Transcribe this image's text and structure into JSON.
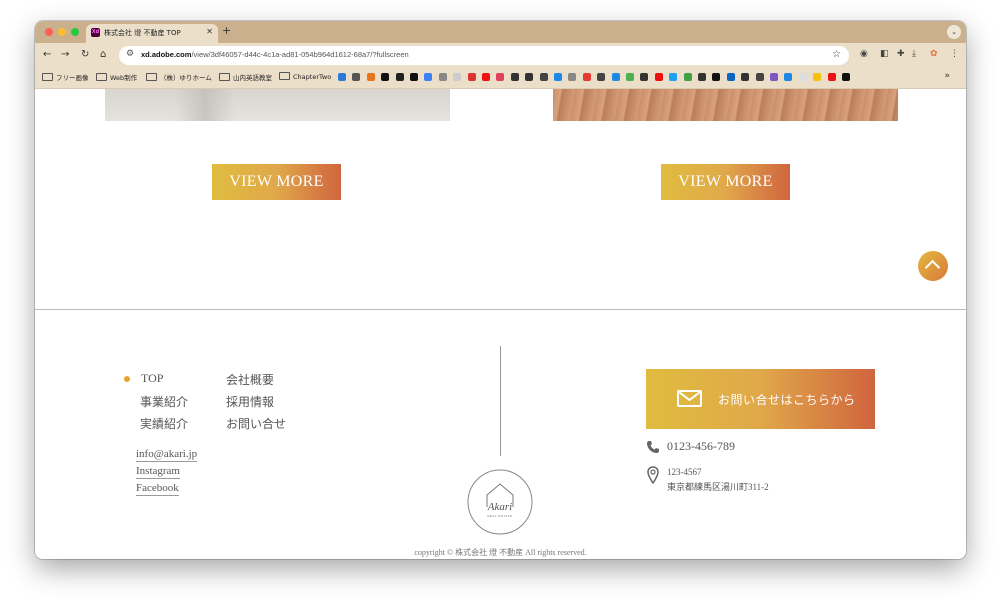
{
  "browser": {
    "tab_title": "株式会社 燈 不動産 TOP",
    "tab_favicon": "Xd",
    "new_tab": "+",
    "url_domain": "xd.adobe.com",
    "url_path": "/view/3df46057-d44c-4c1a-ad81-054b964d1612-68a7/?fullscreen",
    "icons": {
      "back": "back-arrow-icon",
      "forward": "forward-arrow-icon",
      "reload": "reload-icon",
      "home": "home-icon",
      "site_settings": "site-settings-icon",
      "bookmark_star": "star-icon",
      "extensions": "puzzle-icon",
      "download": "download-icon",
      "menu": "kebab-menu-icon"
    },
    "bookmarks": [
      {
        "label": "フリー画像",
        "type": "folder"
      },
      {
        "label": "Web制作",
        "type": "folder"
      },
      {
        "label": "（株）ゆりホーム",
        "type": "folder"
      },
      {
        "label": "山内英語教室",
        "type": "folder"
      },
      {
        "label": "ChapterTwo",
        "type": "folder"
      }
    ],
    "bookmark_icon_colors": [
      "#2b7bd6",
      "#555555",
      "#e8741e",
      "#111111",
      "#222222",
      "#111111",
      "#3b82f6",
      "#888888",
      "#cccccc",
      "#d33",
      "#e11",
      "#e4405f",
      "#333",
      "#333",
      "#444",
      "#1e88e5",
      "#888",
      "#e53935",
      "#444",
      "#1e88e5",
      "#4caf50",
      "#333",
      "#e11",
      "#1da1f2",
      "#43a047",
      "#333",
      "#111",
      "#0a66c2",
      "#333",
      "#444",
      "#7e57c2",
      "#1e88e5",
      "#ddd",
      "#f4c20d",
      "#e11",
      "#111"
    ],
    "bookmarks_more": "»"
  },
  "page": {
    "view_more_label": "VIEW MORE",
    "back_to_top_icon": "chevron-up-icon",
    "footer": {
      "nav": [
        {
          "label": "TOP",
          "active": true
        },
        {
          "label": "事業紹介"
        },
        {
          "label": "実績紹介"
        },
        {
          "label": "会社概要"
        },
        {
          "label": "採用情報"
        },
        {
          "label": "お問い合せ"
        }
      ],
      "links": {
        "email": "info@akari.jp",
        "instagram": "Instagram",
        "facebook": "Facebook"
      },
      "logo": {
        "script_text": "Akari",
        "sub_text": "REAL ESTATE"
      },
      "contact_button": "お問い合せはこちらから",
      "phone": "0123-456-789",
      "postal": "123-4567",
      "address": "東京都練馬区湯川町311-2",
      "copyright": "copyright © 株式会社 燈 不動産 All rights reserved."
    },
    "colors": {
      "accent_gold": "#e0bc3e",
      "accent_orange": "#d0653f",
      "dot": "#e8a52c"
    }
  }
}
